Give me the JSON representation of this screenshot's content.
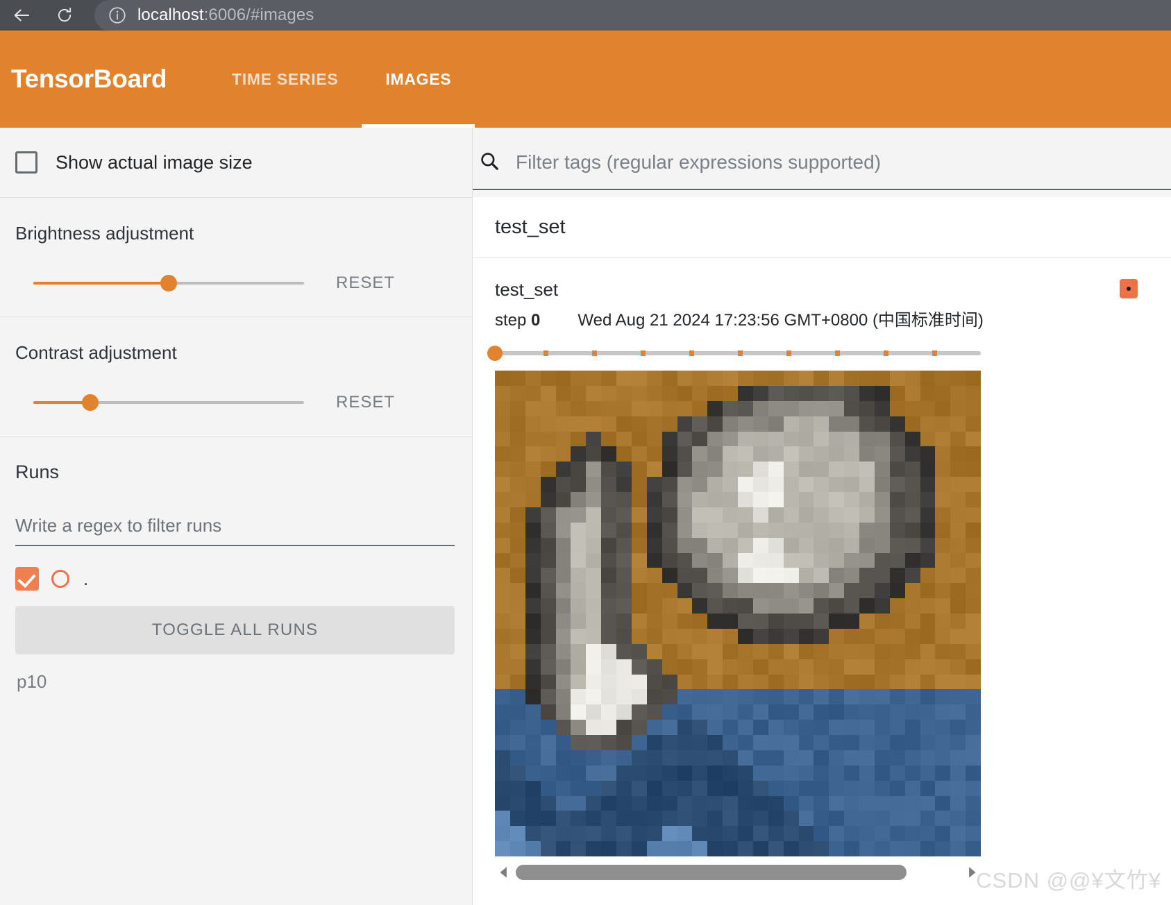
{
  "browser": {
    "back_icon": "back-arrow-icon",
    "reload_icon": "reload-icon",
    "info_icon": "info-circle-icon",
    "url_host": "localhost",
    "url_rest": ":6006/#images"
  },
  "header": {
    "brand": "TensorBoard",
    "tabs": [
      {
        "label": "TIME SERIES",
        "active": false
      },
      {
        "label": "IMAGES",
        "active": true
      }
    ],
    "accent_color": "#e1822f"
  },
  "sidebar": {
    "show_actual_image_size": {
      "label": "Show actual image size",
      "checked": false
    },
    "brightness": {
      "title": "Brightness adjustment",
      "reset_label": "RESET",
      "value_percent": 50
    },
    "contrast": {
      "title": "Contrast adjustment",
      "reset_label": "RESET",
      "value_percent": 21
    },
    "runs": {
      "title": "Runs",
      "filter_placeholder": "Write a regex to filter runs",
      "filter_value": "",
      "items": [
        {
          "label": ".",
          "checked": true,
          "color": "#ef7246"
        }
      ],
      "toggle_all_label": "TOGGLE ALL RUNS",
      "extra_label": "p10"
    }
  },
  "main": {
    "tag_filter": {
      "placeholder": "Filter tags (regular expressions supported)",
      "value": "",
      "icon": "search-icon"
    },
    "tag_group": {
      "name": "test_set"
    },
    "card": {
      "tag_name": "test_set",
      "step_label": "step",
      "step_value": "0",
      "timestamp": "Wed Aug 21 2024 17:23:56 GMT+0800 (中国标准时间)",
      "pin_badge_color": "#ef7246",
      "step_slider": {
        "value_percent": 0,
        "tick_count": 9
      },
      "scrollbar": {
        "left_arrow": "scroll-left-arrow-icon",
        "right_arrow": "scroll-right-arrow-icon",
        "thumb_percent": 88
      }
    }
  },
  "watermark": {
    "text": "CSDN @@¥文竹¥"
  },
  "image_pixels": {
    "rows": 32,
    "cols": 32,
    "palette": {
      "bg_top": "#a8762c",
      "bg_mid": "#8a6327",
      "cat_light": "#b9b6ad",
      "cat_mid": "#8d8a84",
      "cat_dark": "#55524e",
      "cat_vdark": "#3a3836",
      "white": "#e9e7e2",
      "blue_light": "#5d86b4",
      "blue_mid": "#3d6390",
      "blue_dark": "#2b4a70"
    },
    "grid": [
      "AAAAAAAAAAAAAAAAAAAAAAAAAAAAAAAA",
      "AAAAAAAAAAAAAAAABBDDDDDDBBAAAAAA",
      "AAAAAAAAAAAAAABDDEEEEEEDDBAAAAAA",
      "AAAAAAAAAAAABDDEEEECCCEEDDBAAAAA",
      "AAAAAABAAAABDDEECCCCCCCCEEDBAAAA",
      "AAAAABDBAAABDEECCCCCCCCCEEDBBAAA",
      "AAAABDEDBAABDEECCFFCCCCCCEDDBAAA",
      "AAABDDEDBABDEECCFFFCCCCCCEDDBAAA",
      "AAABDEEDDABDECCCFFFCCCCCCEDDBAAA",
      "AABDEECDDABDECCCCFCCCCCCCEDDBAAA",
      "AABDECCDDABDECCCCCCCCCCCEEDDBAAA",
      "AABDECCDDABDEECCCFFCCCCCEEDDBAAA",
      "AABDECCDDABDDEECFFFCCCCEEDDBBAAA",
      "AABDECCDDAABDDEEFFFFCCEEDDBBAAAA",
      "AABDECCDDAAABDDEEEEEEEEDDBBAAAAA",
      "AABDECCDDAAAABDDDEEEEDDDBBAAAAAA",
      "AABDECCDDAAAAABBDDDDDDBBAAAAAAAA",
      "AABDECCDDAAAAAAABBBBBBAAAAAAAAAA",
      "AABDECFFDDAAAAAAAAAAAAAAAAAAAAAA",
      "AABDECFFFDDAAAAAAAAAAAAAAAAAAAAA",
      "AABDECFFFFDDAAAAAAAAAAAAAAAAAAAA",
      "GGBDEFFFFFDDGGGGGGGGGGGGGGGGGGGG",
      "GGGDEFFFFDDGGGGGGGGGGGGGGGGGGGGG",
      "GGGGDEFFDDGGHHGGGGGGGGGGGGGGGGGG",
      "GGGGGDDDDGHHHHHGGGGGGGGGGGGGGGGG",
      "HGGGGGGGGHHHHHHHGGGGGGGGGGGGGGGG",
      "HHGGGGGGHHHHHHHHHGGGGGGGGGGGGGGG",
      "HHHGGGGHHHHHHHHHHHGGGGGGGGGGGGGG",
      "HHHHGGHHHHHHHHHHHHHGGGGGGGGGGGGG",
      "IHHHHHHHHHHHHHHHHHHHGGGGGGGGGGGG",
      "IIHHHHHHHHHIIHHHHHHHHGGGGGGGGGGG",
      "IIIHHHHHHHIIIIHHHHHHHHGGGGGGGGGG"
    ]
  }
}
